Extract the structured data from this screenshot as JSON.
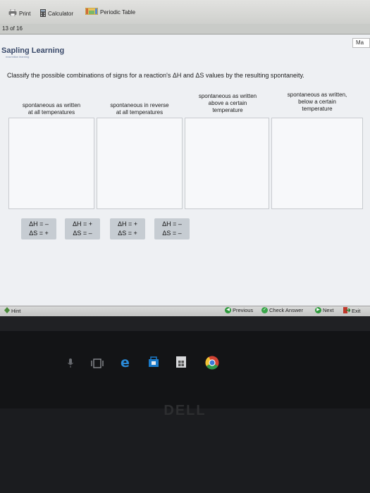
{
  "toolbar": {
    "print": "Print",
    "calculator": "Calculator",
    "periodic_table": "Periodic Table"
  },
  "pagebar": {
    "position": "13 of 16"
  },
  "brand": {
    "name": "Sapling Learning",
    "tagline": "macmillan learning"
  },
  "top_right_button": "Ma",
  "question": "Classify the possible combinations of signs for a reaction's ΔH and ΔS values by the resulting spontaneity.",
  "columns": [
    {
      "line1": "spontaneous as written",
      "line2": "at all temperatures",
      "line3": ""
    },
    {
      "line1": "spontaneous in reverse",
      "line2": "at all temperatures",
      "line3": ""
    },
    {
      "line1": "spontaneous as written",
      "line2": "above a certain",
      "line3": "temperature"
    },
    {
      "line1": "spontaneous as written,",
      "line2": "below a certain",
      "line3": "temperature"
    }
  ],
  "chips": [
    {
      "dh": "ΔH = –",
      "ds": "ΔS = +"
    },
    {
      "dh": "ΔH = +",
      "ds": "ΔS = –"
    },
    {
      "dh": "ΔH = +",
      "ds": "ΔS = +"
    },
    {
      "dh": "ΔH = –",
      "ds": "ΔS = –"
    }
  ],
  "footer": {
    "hint": "Hint",
    "previous": "Previous",
    "check_answer": "Check Answer",
    "next": "Next",
    "exit": "Exit"
  },
  "monitor_brand": "DELL",
  "colors": {
    "brand": "#3a4a6a",
    "chip": "#c6ccd2",
    "previous_green": "#2e9a3c",
    "check_green": "#3aa64a",
    "exit_red": "#c0392b",
    "taskbar": "#131416"
  },
  "taskbar_icons": [
    "microphone-icon",
    "task-view-icon",
    "edge-icon",
    "store-bag-icon",
    "windows-store-icon",
    "chrome-icon"
  ]
}
